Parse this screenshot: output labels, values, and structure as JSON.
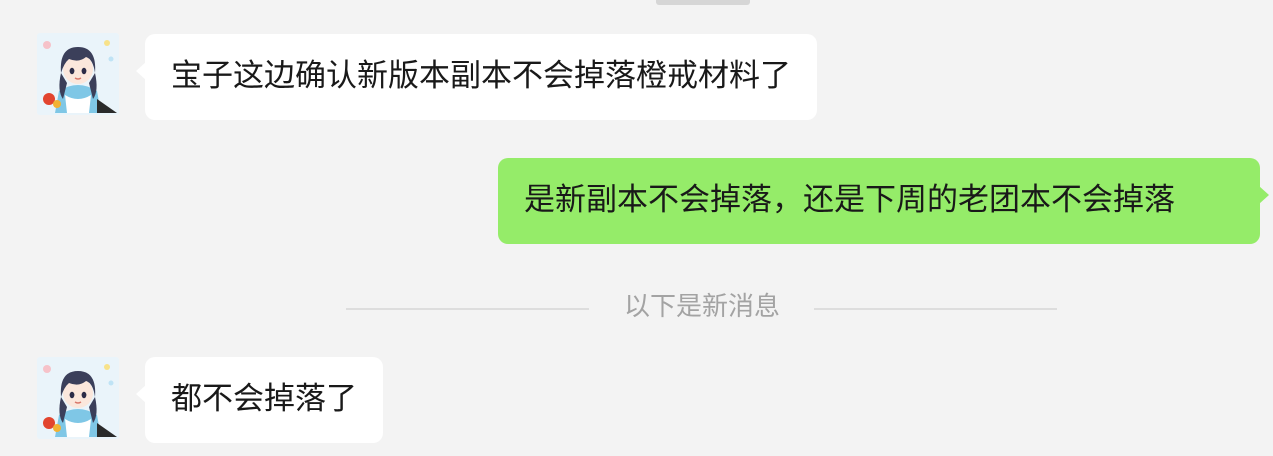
{
  "messages": [
    {
      "direction": "incoming",
      "text": "宝子这边确认新版本副本不会掉落橙戒材料了"
    },
    {
      "direction": "outgoing",
      "text": "是新副本不会掉落，还是下周的老团本不会掉落"
    },
    {
      "direction": "incoming",
      "text": "都不会掉落了"
    }
  ],
  "divider": {
    "label": "以下是新消息"
  },
  "avatar": {
    "icon": "anime-character-avatar-icon"
  },
  "colors": {
    "background": "#f3f3f3",
    "incoming_bubble": "#ffffff",
    "outgoing_bubble": "#95ec69",
    "divider_text": "#a3a3a3"
  }
}
